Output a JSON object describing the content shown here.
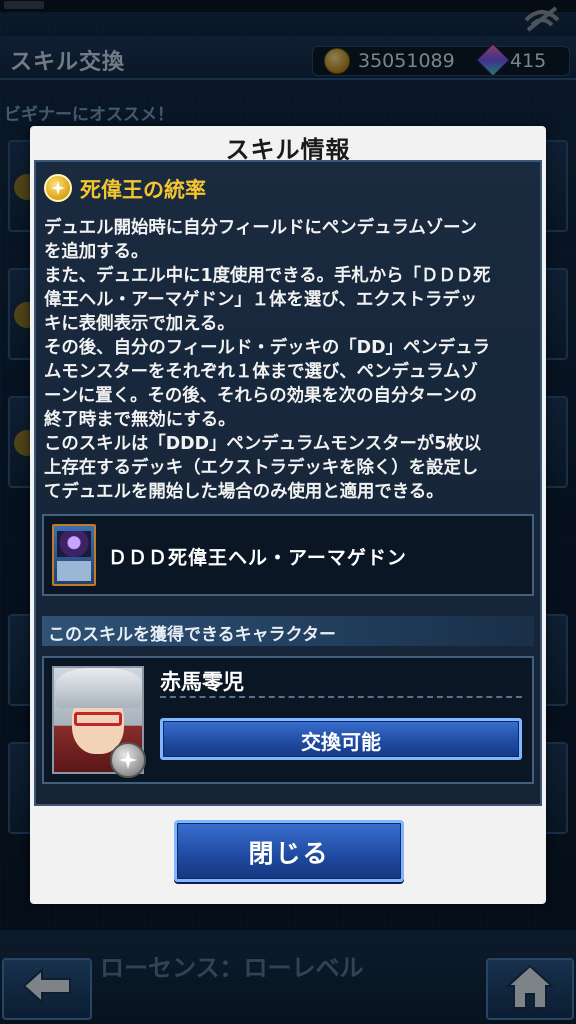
{
  "header": {
    "title": "スキル交換",
    "gold": "35051089",
    "gems": "415"
  },
  "background": {
    "section_label": "ビギナーにオススメ！",
    "bottom_item_text": "ローセンス：ローレベル"
  },
  "modal": {
    "title": "スキル情報",
    "skill_name": "死偉王の統率",
    "description_lines": [
      "デュエル開始時に自分フィールドにペンデュラムゾーン",
      "を追加する。",
      "また、デュエル中に1度使用できる。手札から「ＤＤＤ死",
      "偉王ヘル・アーマゲドン」１体を選び、エクストラデッ",
      "キに表側表示で加える。",
      "その後、自分のフィールド・デッキの「DD」ペンデュラ",
      "ムモンスターをそれぞれ１体まで選び、ペンデュラムゾ",
      "ーンに置く。その後、それらの効果を次の自分ターンの",
      "終了時まで無効にする。",
      "このスキルは「DDD」ペンデュラムモンスターが5枚以",
      "上存在するデッキ（エクストラデッキを除く）を設定し",
      "てデュエルを開始した場合のみ使用と適用できる。"
    ],
    "card_name": "ＤＤＤ死偉王ヘル・アーマゲドン",
    "character_section_label": "このスキルを獲得できるキャラクター",
    "character_name": "赤馬零児",
    "exchange_button": "交換可能",
    "close_button": "閉じる"
  },
  "icons": {
    "skill": "star-medal-icon",
    "currency_gold": "gold-coins-icon",
    "currency_gem": "gem-icon",
    "back": "back-arrow-icon",
    "home": "home-icon"
  },
  "colors": {
    "skill_name": "#f4c531",
    "button_blue": "#1f4aa0",
    "button_border": "#7fb6ff"
  }
}
